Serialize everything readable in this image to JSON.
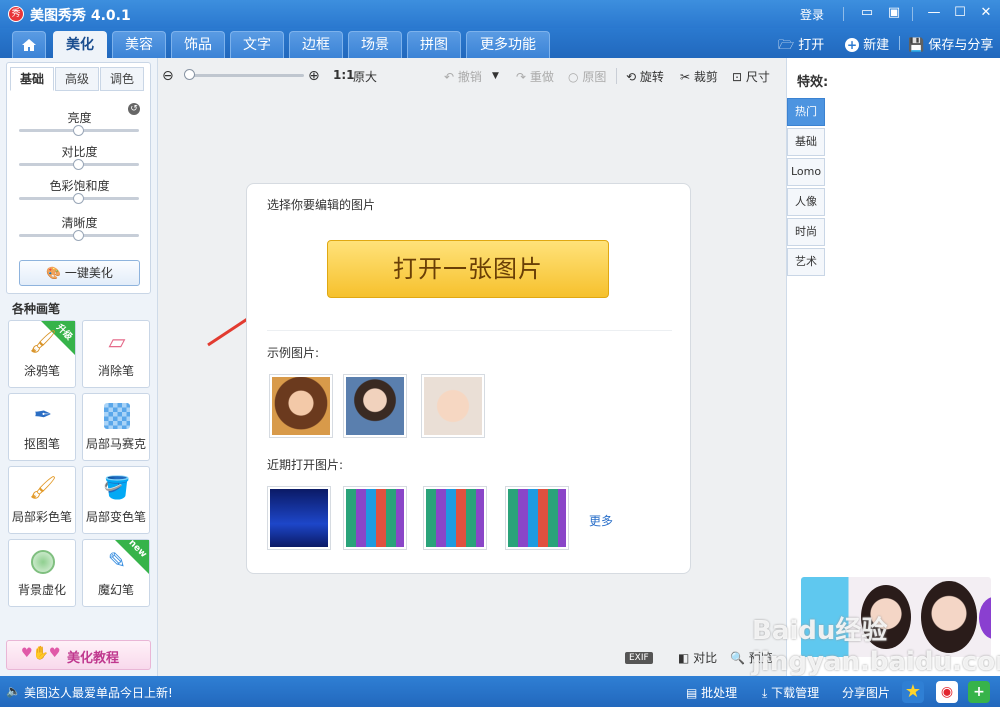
{
  "app": {
    "title": "美图秀秀 4.0.1",
    "logo_text": "秀",
    "login": "登录"
  },
  "nav": {
    "home_icon": "home-icon",
    "tabs": [
      "美化",
      "美容",
      "饰品",
      "文字",
      "边框",
      "场景",
      "拼图",
      "更多功能"
    ],
    "active_tab": "美化",
    "open": "打开",
    "new": "新建",
    "save_share": "保存与分享"
  },
  "left": {
    "subtabs": [
      "基础",
      "高级",
      "调色"
    ],
    "sliders": [
      {
        "label": "亮度",
        "value": 0.5
      },
      {
        "label": "对比度",
        "value": 0.5
      },
      {
        "label": "色彩饱和度",
        "value": 0.5
      },
      {
        "label": "清晰度",
        "value": 0.5
      }
    ],
    "one_key": "一键美化",
    "brushes_heading": "各种画笔",
    "tools": [
      {
        "label": "涂鸦笔",
        "badge": "升级"
      },
      {
        "label": "消除笔",
        "badge": ""
      },
      {
        "label": "抠图笔",
        "badge": ""
      },
      {
        "label": "局部马赛克",
        "badge": ""
      },
      {
        "label": "局部彩色笔",
        "badge": ""
      },
      {
        "label": "局部变色笔",
        "badge": ""
      },
      {
        "label": "背景虚化",
        "badge": ""
      },
      {
        "label": "魔幻笔",
        "badge": "new"
      }
    ],
    "tutorial": "美化教程"
  },
  "toolbar": {
    "ratio": "1:1",
    "original_size": "原大",
    "undo": "撤销",
    "redo": "重做",
    "original": "原图",
    "rotate": "旋转",
    "crop": "裁剪",
    "size": "尺寸"
  },
  "card": {
    "prompt": "选择你要编辑的图片",
    "open_button": "打开一张图片",
    "sample_heading": "示例图片:",
    "recent_heading": "近期打开图片:",
    "more": "更多"
  },
  "bottom_tools": {
    "exif": "EXIF",
    "compare": "对比",
    "preview": "预览"
  },
  "effects": {
    "heading": "特效:",
    "tabs": [
      "热门",
      "基础",
      "Lomo",
      "人像",
      "时尚",
      "艺术"
    ],
    "active_tab": "热门"
  },
  "status": {
    "news": "美图达人最爱单品今日上新!",
    "batch": "批处理",
    "download": "下载管理",
    "share": "分享图片"
  },
  "watermark": "Baidu经验 jingyan.baidu.com",
  "colors": {
    "accent": "#2a78cf",
    "open_button": "#f6c12d",
    "arrow": "#e23b30"
  }
}
